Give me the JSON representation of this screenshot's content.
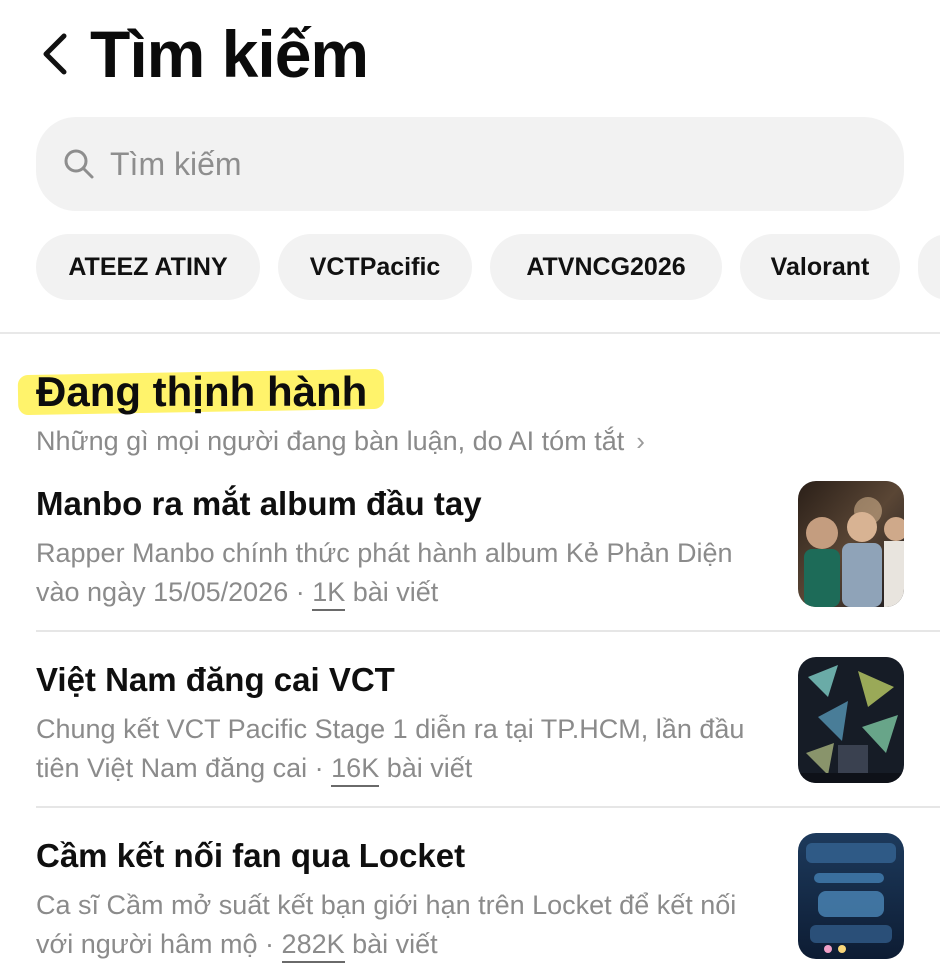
{
  "header": {
    "title": "Tìm kiếm"
  },
  "search": {
    "placeholder": "Tìm kiếm"
  },
  "chips": [
    "ATEEZ ATINY",
    "VCTPacific",
    "ATVNCG2026",
    "Valorant"
  ],
  "trending": {
    "title": "Đang thịnh hành",
    "subtitle": "Những gì mọi người đang bàn luận, do AI tóm tắt",
    "items": [
      {
        "headline": "Manbo ra mắt album đầu tay",
        "desc_prefix": "Rapper Manbo chính thức phát hành album Kẻ Phản Diện vào ngày 15/05/2026 · ",
        "count": "1K",
        "count_suffix": " bài viết",
        "thumbnail": "photo-thumbnail"
      },
      {
        "headline": "Việt Nam đăng cai VCT",
        "desc_prefix": "Chung kết VCT Pacific Stage 1 diễn ra tại TP.HCM, lần đầu tiên Việt Nam đăng cai · ",
        "count": "16K",
        "count_suffix": " bài viết",
        "thumbnail": "photo-thumbnail"
      },
      {
        "headline": "Cầm kết nối fan qua Locket",
        "desc_prefix": "Ca sĩ Cầm mở suất kết bạn giới hạn trên Locket để kết nối với người hâm mộ · ",
        "count": "282K",
        "count_suffix": " bài viết",
        "thumbnail": "photo-thumbnail"
      }
    ]
  },
  "colors": {
    "highlight": "#fff36b",
    "chip_bg": "#f2f2f2",
    "search_bg": "#f2f2f2",
    "muted_text": "#8b8b8b"
  }
}
